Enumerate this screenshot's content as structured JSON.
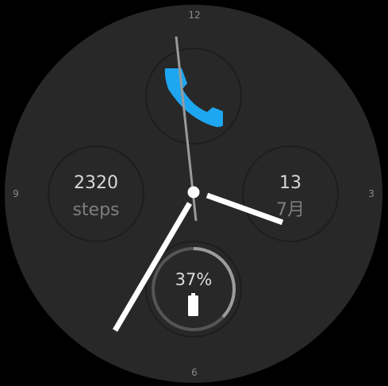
{
  "dial": {
    "numerals": {
      "top": "12",
      "right": "3",
      "bottom": "6",
      "left": "9"
    }
  },
  "complications": {
    "top": {
      "icon": "phone-icon",
      "icon_color": "#1ea6f0"
    },
    "left": {
      "value": "2320",
      "label": "steps"
    },
    "right": {
      "value": "13",
      "label": "7月"
    },
    "bottom": {
      "value": "37%",
      "progress": 0.37,
      "icon": "battery-icon"
    }
  },
  "hands": {
    "hour_color": "#ffffff",
    "minute_color": "#ffffff",
    "second_color": "#9a9a9a"
  },
  "colors": {
    "face": "#282828",
    "background": "#000000",
    "progress_track": "#555555",
    "progress_fill": "#9c9c9c"
  }
}
